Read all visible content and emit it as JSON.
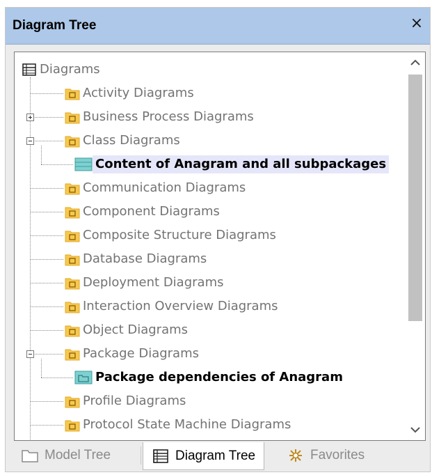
{
  "panel": {
    "title": "Diagram Tree",
    "close_glyph": "×"
  },
  "tree": {
    "root": {
      "label": "Diagrams",
      "icon": "diagram-tree-icon"
    },
    "items": [
      {
        "label": "Activity Diagrams",
        "icon": "activity-folder-icon"
      },
      {
        "label": "Business Process Diagrams",
        "icon": "business-process-folder-icon",
        "expander": "plus"
      },
      {
        "label": "Class Diagrams",
        "icon": "class-folder-icon",
        "expander": "minus"
      },
      {
        "label": "Content of Anagram and all subpackages",
        "icon": "class-diagram-icon",
        "child": true,
        "selected": true
      },
      {
        "label": "Communication Diagrams",
        "icon": "communication-folder-icon"
      },
      {
        "label": "Component Diagrams",
        "icon": "component-folder-icon"
      },
      {
        "label": "Composite Structure Diagrams",
        "icon": "composite-structure-folder-icon"
      },
      {
        "label": "Database Diagrams",
        "icon": "database-folder-icon"
      },
      {
        "label": "Deployment Diagrams",
        "icon": "deployment-folder-icon"
      },
      {
        "label": "Interaction Overview Diagrams",
        "icon": "interaction-overview-folder-icon"
      },
      {
        "label": "Object Diagrams",
        "icon": "object-folder-icon"
      },
      {
        "label": "Package Diagrams",
        "icon": "package-folder-icon",
        "expander": "minus"
      },
      {
        "label": "Package dependencies of Anagram",
        "icon": "package-diagram-icon",
        "child": true,
        "bold": true
      },
      {
        "label": "Profile Diagrams",
        "icon": "profile-folder-icon"
      },
      {
        "label": "Protocol State Machine Diagrams",
        "icon": "protocol-state-machine-folder-icon"
      }
    ]
  },
  "scrollbar": {
    "up_icon": "chevron-up-icon",
    "down_icon": "chevron-down-icon",
    "position_fraction": 0.0
  },
  "tabs": [
    {
      "label": "Model Tree",
      "icon": "folder-outline-icon",
      "active": false
    },
    {
      "label": "Diagram Tree",
      "icon": "diagram-tree-icon",
      "active": true
    },
    {
      "label": "Favorites",
      "icon": "favorites-icon",
      "active": false
    }
  ],
  "colors": {
    "titlebar": "#adc8e8",
    "folder": "#f4c44a",
    "selection": "#e6e6fa",
    "diagram_teal": "#4fb6b6"
  }
}
